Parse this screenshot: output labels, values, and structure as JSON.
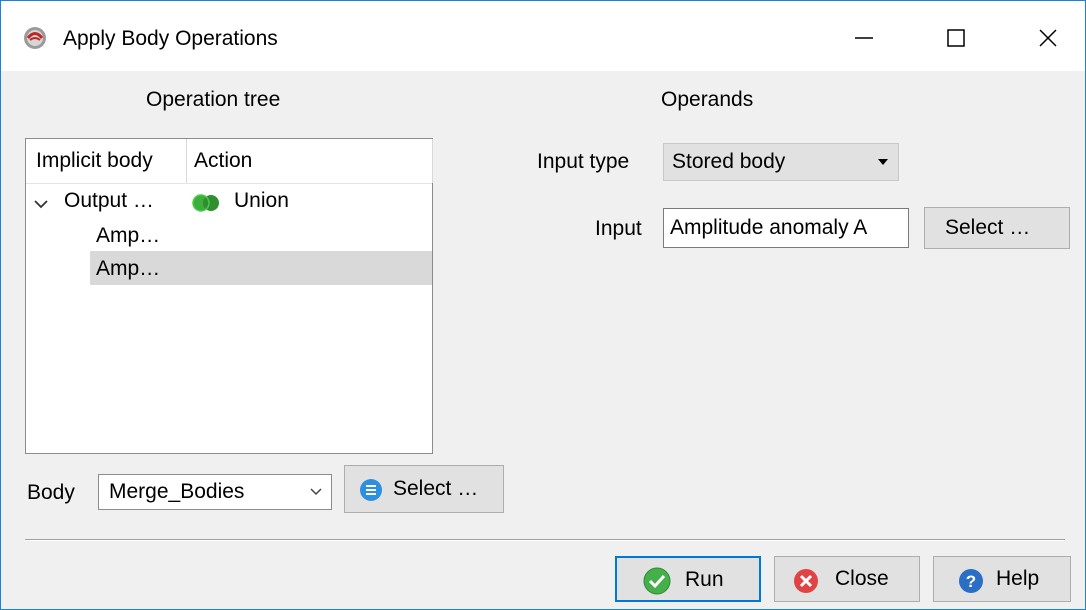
{
  "window": {
    "title": "Apply Body Operations",
    "icon": "app-logo-icon"
  },
  "titlebar_buttons": {
    "minimize": "minimize-icon",
    "maximize": "maximize-icon",
    "close": "close-icon"
  },
  "operation_tree": {
    "heading": "Operation tree",
    "columns": [
      "Implicit body",
      "Action"
    ],
    "rows": [
      {
        "body": "Output …",
        "action": "Union",
        "action_icon": "union-icon",
        "expanded": true
      },
      {
        "body": "Amp…",
        "action": ""
      },
      {
        "body": "Amp…",
        "action": "",
        "selected": true
      }
    ]
  },
  "body_picker": {
    "label": "Body",
    "value": "Merge_Bodies",
    "select_label": "Select …",
    "select_icon": "list-icon"
  },
  "operands": {
    "heading": "Operands",
    "input_type_label": "Input type",
    "input_type_value": "Stored body",
    "input_label": "Input",
    "input_value": "Amplitude anomaly A",
    "select_label": "Select …"
  },
  "footer": {
    "run_label": "Run",
    "close_label": "Close",
    "help_label": "Help",
    "run_icon": "check-icon",
    "close_icon": "cancel-icon",
    "help_icon": "help-icon"
  },
  "colors": {
    "accent": "#0078d7",
    "green": "#3cae3c",
    "red": "#e04343",
    "blue": "#2a6ec5"
  }
}
